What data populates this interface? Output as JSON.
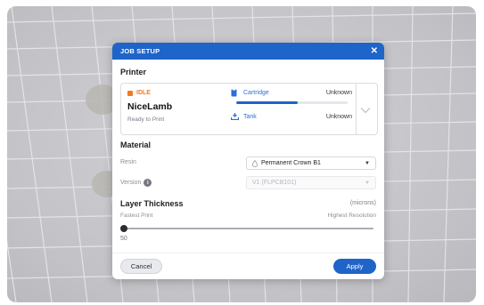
{
  "dialog": {
    "title": "JOB SETUP",
    "close_icon": "close-icon"
  },
  "printer": {
    "section_title": "Printer",
    "status": "IDLE",
    "status_color": "#f07b22",
    "name": "NiceLamb",
    "sub_status": "Ready to Print",
    "cartridge": {
      "label": "Cartridge",
      "value": "Unknown",
      "icon": "cartridge-icon",
      "progress_fraction": 0.55
    },
    "tank": {
      "label": "Tank",
      "value": "Unknown",
      "icon": "tank-icon"
    },
    "expand_icon": "chevron-down-icon"
  },
  "material": {
    "section_title": "Material",
    "resin_label": "Resin",
    "resin_value": "Permanent Crown B1",
    "resin_icon": "resin-drop-icon",
    "version_label": "Version",
    "version_value": "V1 (FLPCB101)",
    "info_icon": "info-icon"
  },
  "layer": {
    "section_title": "Layer Thickness",
    "units": "(microns)",
    "left_label": "Fastest Print",
    "right_label": "Highest Resolution",
    "value": "50",
    "slider_fraction": 0.0
  },
  "footer": {
    "cancel_label": "Cancel",
    "apply_label": "Apply"
  },
  "colors": {
    "accent": "#1f64c8",
    "header": "#1f64c8",
    "link": "#2a6fd8",
    "status_idle": "#f07b22"
  }
}
